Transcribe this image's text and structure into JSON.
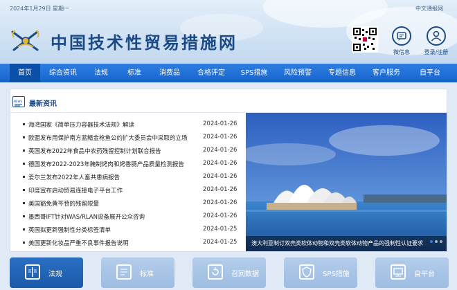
{
  "header": {
    "date": "2024年1月29日",
    "weekday": "星期一",
    "lang_link": "中文通报网",
    "site_title": "中国技术性贸易措施网",
    "buttons": [
      {
        "label": "微信息",
        "icon": "chat-icon"
      },
      {
        "label": "登录/注册",
        "icon": "user-icon"
      }
    ]
  },
  "nav": {
    "items": [
      "首页",
      "综合资讯",
      "法规",
      "标准",
      "消费品",
      "合格评定",
      "SPS措施",
      "风险预警",
      "专题信息",
      "客户服务",
      "自平台"
    ],
    "active": "首页"
  },
  "news": {
    "section_title": "最新资讯",
    "items": [
      {
        "title": "海湾国家《简单压力容器技术法规》解读",
        "date": "2024-01-26"
      },
      {
        "title": "欧盟发布用保护南方蓝鳍金枪鱼公约扩大委员会中采取的立场",
        "date": "2024-01-26"
      },
      {
        "title": "英国发布2022年食品中农药残留控制计划联合报告",
        "date": "2024-01-26"
      },
      {
        "title": "德国发布2022-2023年腌制烤肉和烤香肠产品质量检测报告",
        "date": "2024-01-26"
      },
      {
        "title": "爱尔兰发布2022年人畜共患病报告",
        "date": "2024-01-26"
      },
      {
        "title": "印度宣布启动贸易连接电子平台工作",
        "date": "2024-01-26"
      },
      {
        "title": "美国豁免黄芩苷的残留限量",
        "date": "2024-01-26"
      },
      {
        "title": "墨西哥IFT针对WAS/RLAN设备展开公众咨询",
        "date": "2024-01-26"
      },
      {
        "title": "英国拟更新强制性分类标签清单",
        "date": "2024-01-25"
      },
      {
        "title": "美国更新化妆品严重不良事件报告说明",
        "date": "2024-01-25"
      }
    ],
    "photo_caption": "澳大利亚制订双壳类软体动物和双壳类软体动物产品的强制性认证要求"
  },
  "quick_links": [
    {
      "label": "法规",
      "icon": "book-icon",
      "active": true
    },
    {
      "label": "标准",
      "icon": "document-icon",
      "active": false
    },
    {
      "label": "召回数据",
      "icon": "recall-icon",
      "active": false
    },
    {
      "label": "SPS措施",
      "icon": "shield-icon",
      "active": false
    },
    {
      "label": "自平台",
      "icon": "platform-icon",
      "active": false
    }
  ],
  "colors": {
    "brand_blue": "#1c4a86",
    "nav_blue": "#1666cf",
    "nav_active": "#0a4fa8"
  }
}
